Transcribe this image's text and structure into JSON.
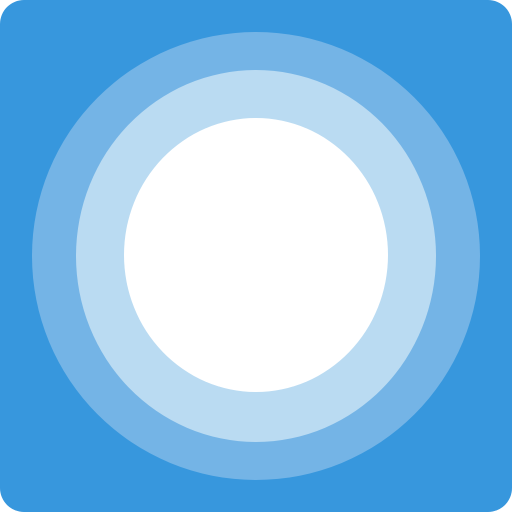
{
  "icon": {
    "name": "cortana-app-icon",
    "colors": {
      "background": "#3797dd",
      "outer_ring": "#74b4e6",
      "middle_ring": "#badbf2",
      "center": "#ffffff"
    }
  }
}
